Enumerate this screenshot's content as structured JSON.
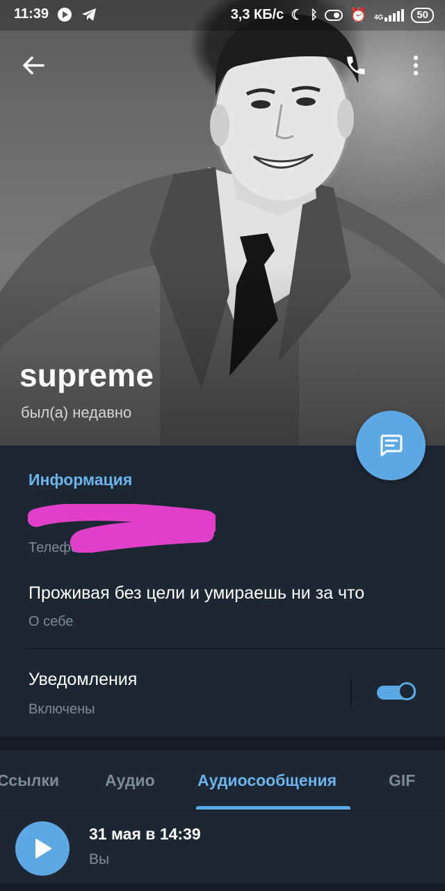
{
  "status_bar": {
    "time": "11:39",
    "network_speed": "3,3 КБ/с",
    "signal_label": "4G",
    "battery": "50",
    "icons": [
      "play-circle-icon",
      "telegram-icon",
      "moon-icon",
      "bluetooth-icon",
      "toggle-icon",
      "alarm-icon",
      "signal-icon"
    ]
  },
  "profile": {
    "name": "supreme",
    "status": "был(а) недавно"
  },
  "info": {
    "section_title": "Информация",
    "phone_value": "+",
    "phone_label": "Телефон",
    "bio_value": "Проживая без цели и умираешь ни за что",
    "bio_label": "О себе",
    "notifications_title": "Уведомления",
    "notifications_state": "Включены",
    "notifications_enabled": true
  },
  "tabs": [
    {
      "label": "Ссылки",
      "active": false
    },
    {
      "label": "Аудио",
      "active": false
    },
    {
      "label": "Аудиосообщения",
      "active": true
    },
    {
      "label": "GIF",
      "active": false
    }
  ],
  "audio_item": {
    "date": "31 мая в 14:39",
    "author": "Вы"
  },
  "colors": {
    "accent": "#5ea9e3",
    "accent_text": "#6cb4ee",
    "panel": "#1d2733",
    "background": "#151c26",
    "muted_text": "#7d8b99",
    "redaction": "#e040c8"
  }
}
